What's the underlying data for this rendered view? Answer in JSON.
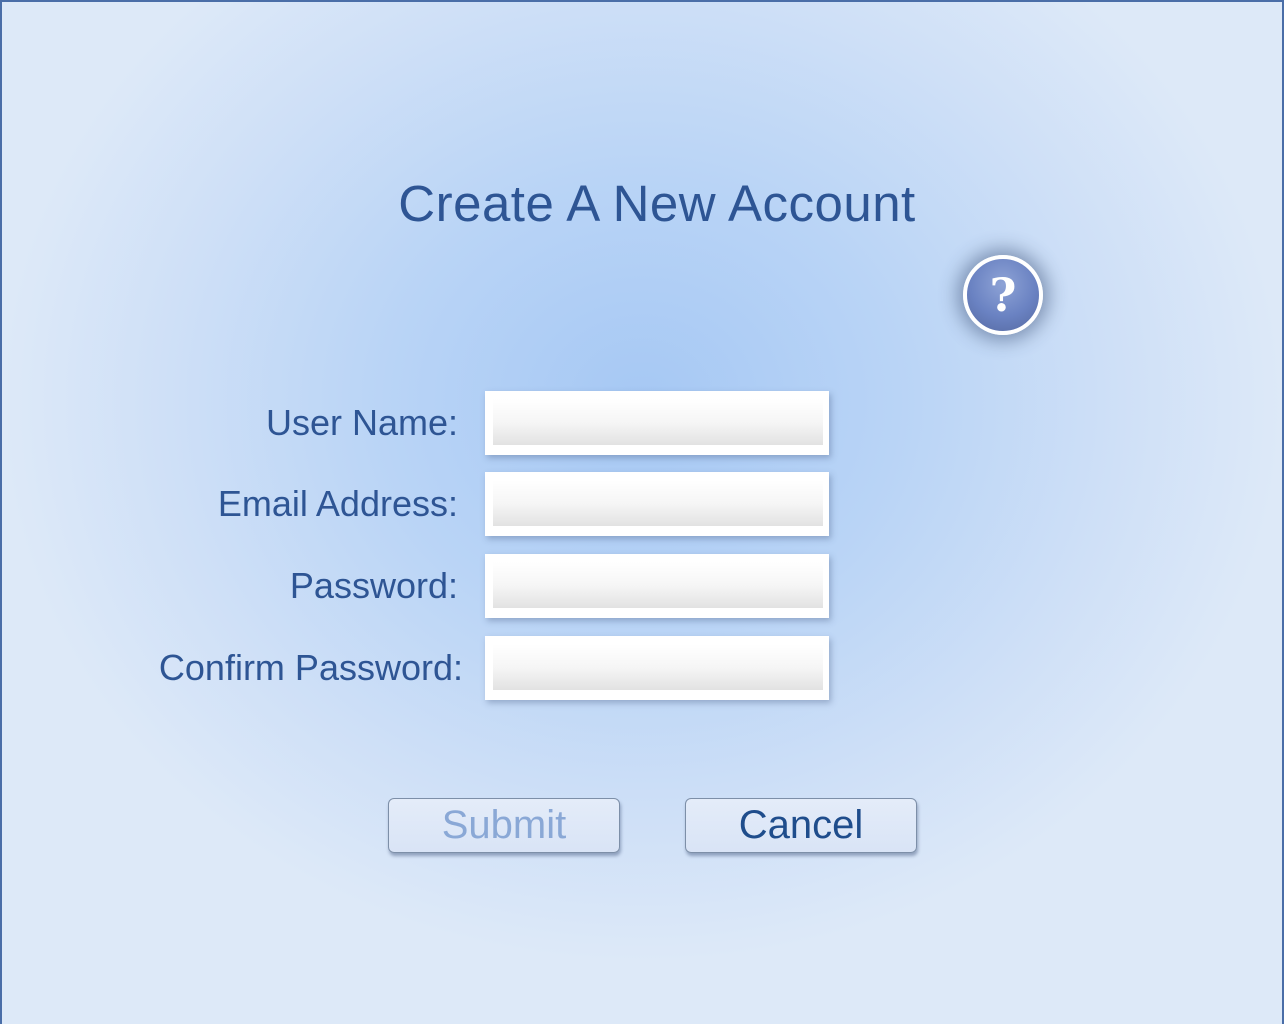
{
  "page": {
    "title": "Create A New Account",
    "help_icon": "question-mark-circle",
    "help_glyph": "?"
  },
  "form": {
    "fields": [
      {
        "label": "User Name:",
        "value": "",
        "placeholder": ""
      },
      {
        "label": "Email Address:",
        "value": "",
        "placeholder": ""
      },
      {
        "label": "Password:",
        "value": "",
        "placeholder": ""
      },
      {
        "label": "Confirm Password:",
        "value": "",
        "placeholder": ""
      }
    ]
  },
  "buttons": {
    "submit_label": "Submit",
    "submit_state": "disabled",
    "cancel_label": "Cancel"
  },
  "colors": {
    "text": "#2e5594",
    "submit_text_disabled": "#8aa8d6",
    "background": "#b9d4f6",
    "border": "#4a6ea8"
  }
}
